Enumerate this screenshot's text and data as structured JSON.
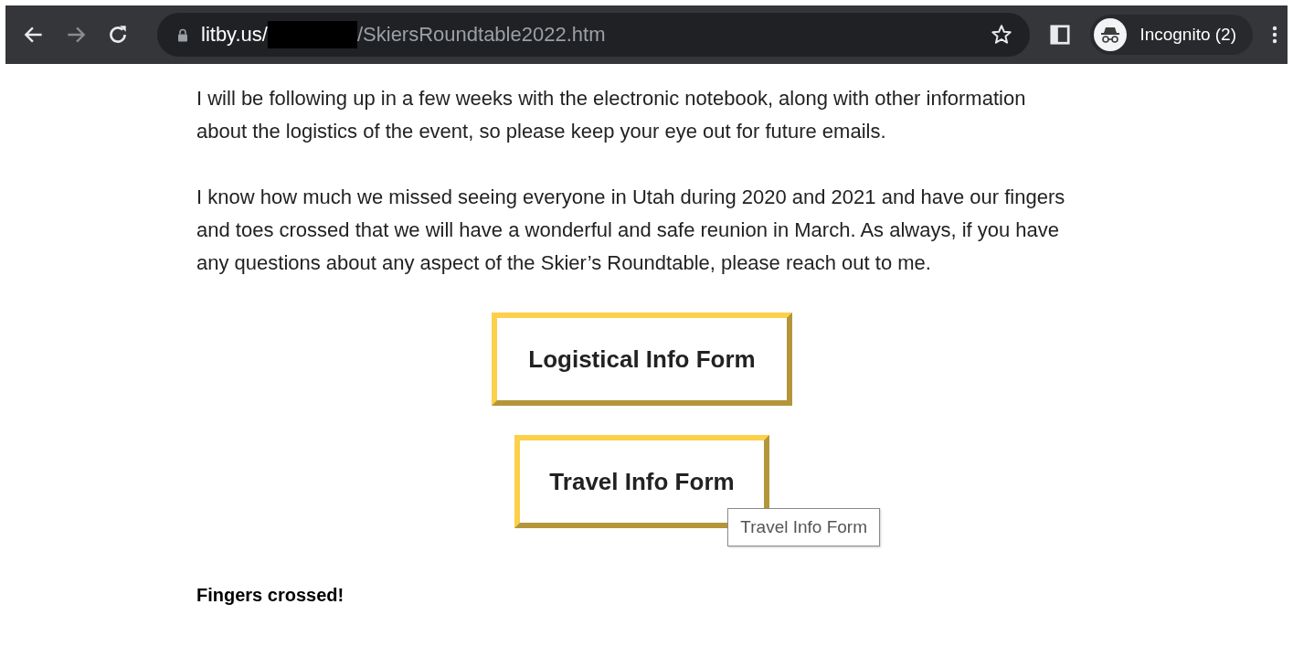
{
  "browser": {
    "url_host": "litby.us/",
    "url_path": "/SkiersRoundtable2022.htm",
    "profile": "Incognito (2)"
  },
  "paragraphs": [
    "I will be following up in a few weeks with the electronic notebook, along with other information about the logistics of the event, so please keep your eye out for future emails.",
    "I know how much we missed seeing everyone in Utah during 2020 and 2021 and have our fingers and toes crossed that we will have a wonderful and safe reunion in March.  As always, if you have any questions about any aspect of the Skier’s Roundtable, please reach out to me."
  ],
  "buttons": [
    {
      "label": "Logistical Info Form"
    },
    {
      "label": "Travel Info Form",
      "tooltip": "Travel Info Form"
    }
  ],
  "closing": "Fingers crossed!"
}
